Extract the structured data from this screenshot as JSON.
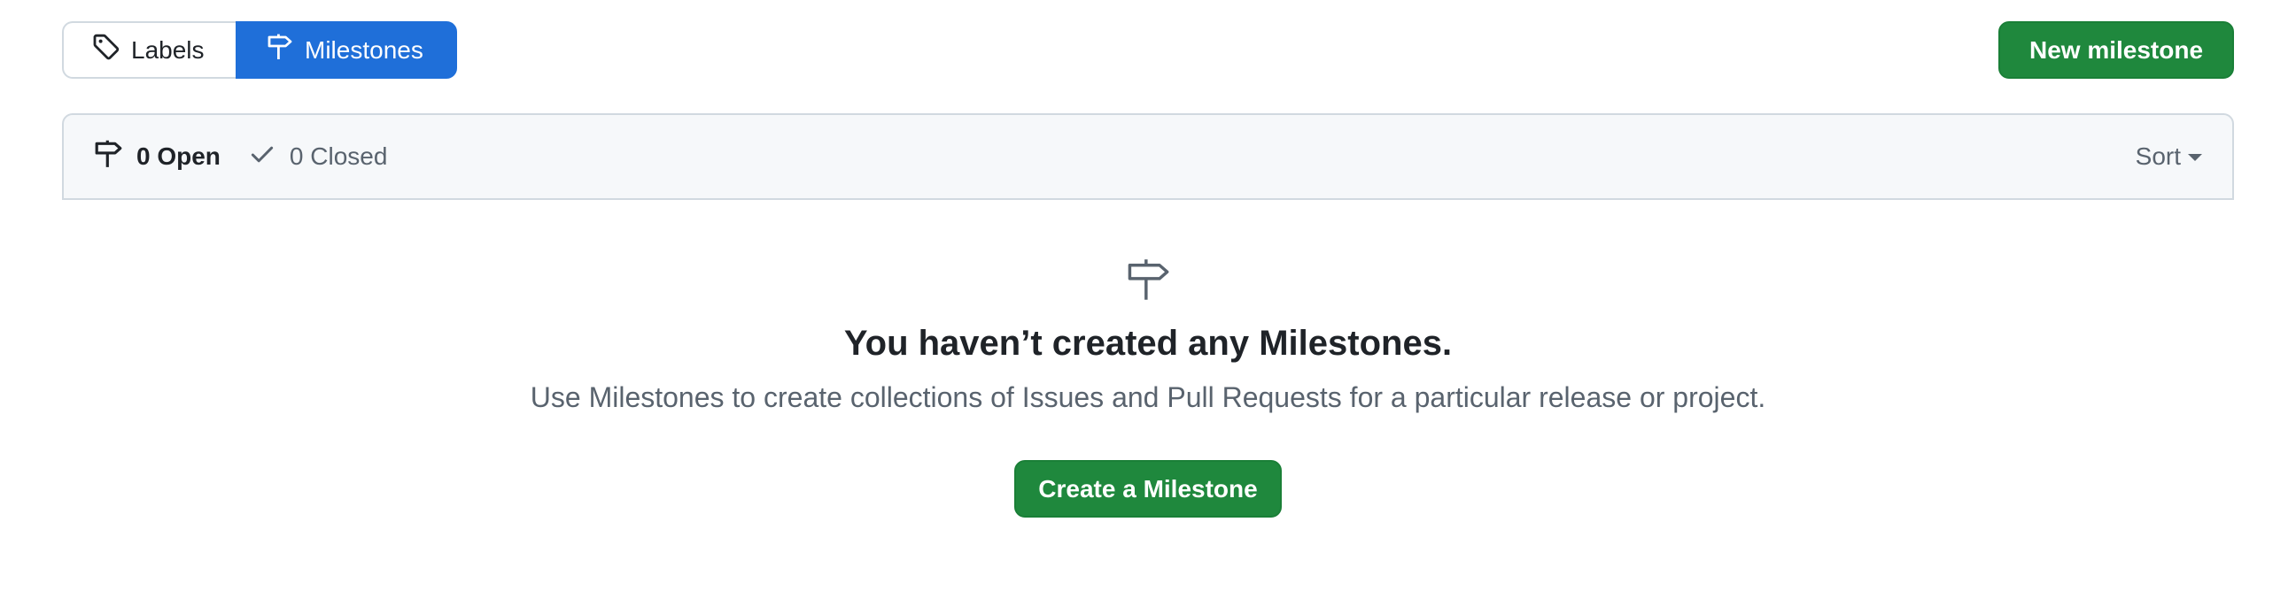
{
  "tabs": {
    "labels": "Labels",
    "milestones": "Milestones"
  },
  "actions": {
    "new_milestone": "New milestone"
  },
  "filter": {
    "open": "0 Open",
    "closed": "0 Closed",
    "sort": "Sort"
  },
  "blankslate": {
    "title": "You haven’t created any Milestones.",
    "description": "Use Milestones to create collections of Issues and Pull Requests for a particular release or project.",
    "button": "Create a Milestone"
  },
  "icons": {
    "labels": "tag-icon",
    "milestones": "milestone-icon",
    "closed": "check-icon",
    "sort": "caret-down-icon"
  },
  "colors": {
    "primary_blue": "#1f6fd9",
    "primary_green": "#1f883d",
    "muted_text": "#59636e",
    "border": "#d1d9e0"
  }
}
